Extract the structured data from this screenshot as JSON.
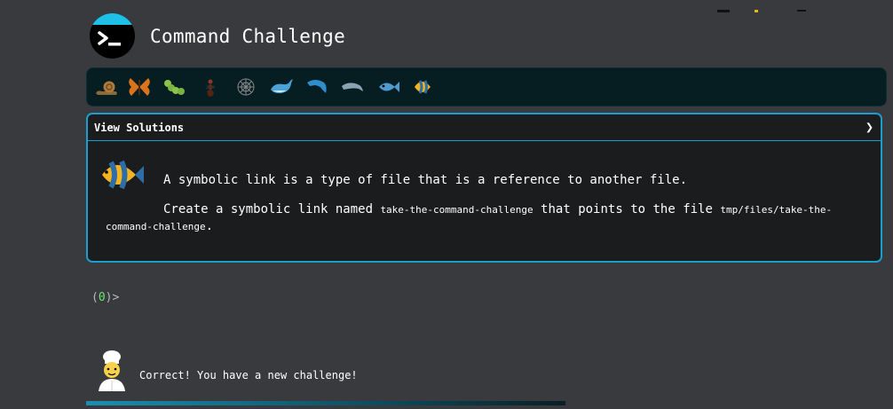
{
  "app": {
    "title": "Command Challenge"
  },
  "progress": {
    "icons": [
      "snail-icon",
      "butterfly-icon",
      "caterpillar-icon",
      "ant-icon",
      "spider-web-icon",
      "whale-icon",
      "dolphin-icon",
      "dolphin-2-icon",
      "fish-icon",
      "tropical-fish-icon"
    ]
  },
  "card": {
    "header_label": "View Solutions",
    "chevron": "❯",
    "intro": "A symbolic link is a type of file that is a reference to another file.",
    "task_prefix": "Create a symbolic link named ",
    "link_name": "take-the-command-challenge",
    "task_middle": " that points to the file ",
    "target_path": "tmp/files/take-the-command-challenge",
    "task_suffix": "."
  },
  "prompt": {
    "open": "(",
    "count": "0",
    "close": ")>"
  },
  "feedback": {
    "message": "Correct! You have a new challenge!"
  },
  "colors": {
    "accent": "#1a9ecd",
    "background": "#383a3d",
    "card": "#1b1c1e"
  }
}
